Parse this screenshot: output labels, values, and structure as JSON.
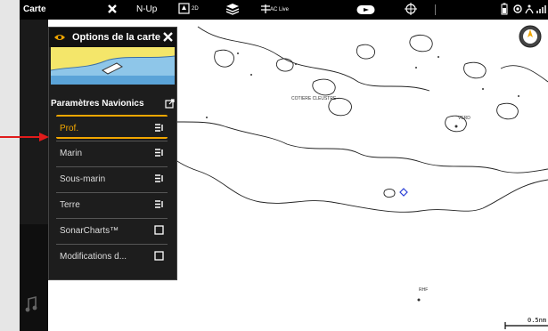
{
  "topbar": {
    "title": "Carte",
    "orientation": "N-Up",
    "view_mode": "2D",
    "ac_live": "AC Live"
  },
  "panel": {
    "title": "Options de la carte",
    "section_title": "Paramètres Navionics",
    "items": [
      {
        "label": "Prof.",
        "icon": "list-icon",
        "selected": true
      },
      {
        "label": "Marin",
        "icon": "list-icon",
        "selected": false
      },
      {
        "label": "Sous-marin",
        "icon": "list-icon",
        "selected": false
      },
      {
        "label": "Terre",
        "icon": "list-icon",
        "selected": false
      },
      {
        "label": "SonarCharts™",
        "icon": "checkbox-icon",
        "selected": false
      },
      {
        "label": "Modifications d...",
        "icon": "checkbox-icon",
        "selected": false
      }
    ]
  },
  "map": {
    "scale": "0.5nm",
    "label_cotiere": "COTIERE CLEUSTRE",
    "label_vrd": "VERD",
    "label_rhf": "RHF"
  },
  "colors": {
    "accent": "#f1a600",
    "pointer": "#e01b1b",
    "panel_bg": "#1d1d1d",
    "topbar_bg": "#000000"
  }
}
